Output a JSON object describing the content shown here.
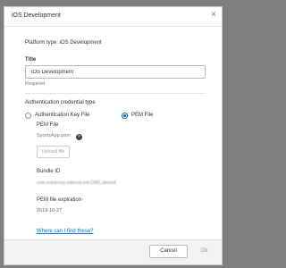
{
  "dialog": {
    "title": "iOS Development",
    "close_icon": "close-icon"
  },
  "platform": {
    "text": "Platform type: iOS Development"
  },
  "title_field": {
    "label": "Title",
    "value": "iOS Development",
    "hint": "Required"
  },
  "auth": {
    "heading": "Authentication credential type",
    "options": [
      {
        "label": "Authentication Key File",
        "selected": false
      },
      {
        "label": "PEM File",
        "selected": true
      }
    ]
  },
  "pem": {
    "heading": "PEM File",
    "file_name": "SportsApp.pem",
    "remove_icon": "close-circle-icon",
    "upload_label": "Upload file"
  },
  "bundle": {
    "heading": "Bundle ID",
    "value": "com.crackcorp.internal.ent.CNIC.demo4"
  },
  "expiration": {
    "heading": "PEM file expiration",
    "value": "2019-10-27"
  },
  "help_link": "Where can I find these?",
  "footer": {
    "cancel_label": "Cancel",
    "ok_label": "Ok"
  },
  "colors": {
    "overlay": "#7f7f7f",
    "accent": "#0070d2",
    "text": "#333333",
    "muted": "#7a7a7a"
  }
}
